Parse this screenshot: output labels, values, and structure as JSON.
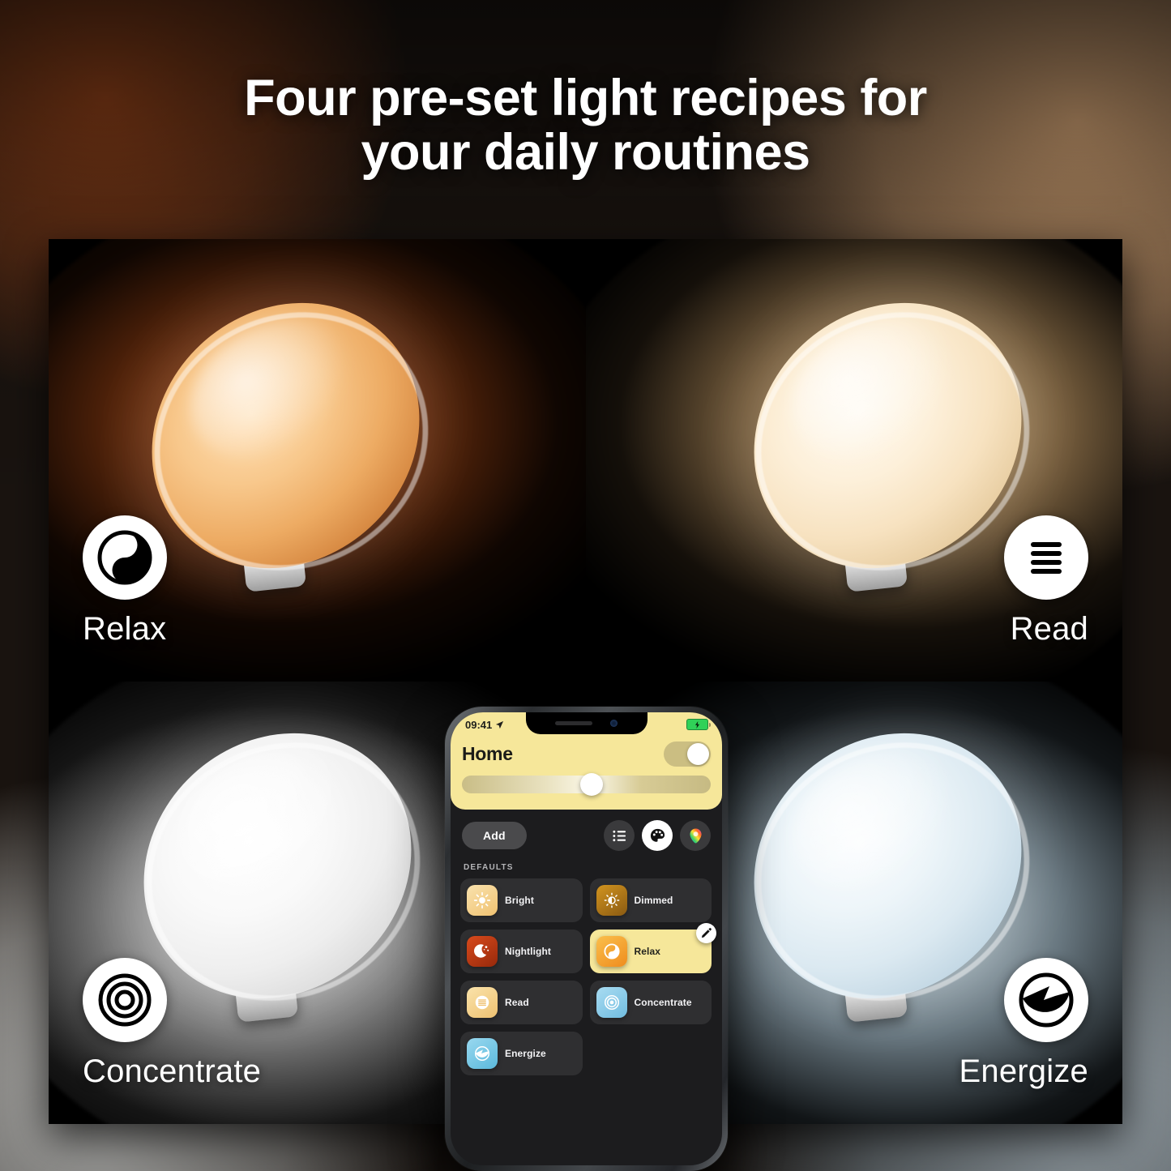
{
  "headline": {
    "line1": "Four pre-set light recipes for",
    "line2": "your daily routines"
  },
  "colors": {
    "accent_yellow": "#f6e79a",
    "panel_black": "#000000",
    "badge_white": "#ffffff",
    "battery_green": "#30d158",
    "relax_lamp": "#edab63",
    "read_lamp": "#f7e2c0",
    "concentrate_lamp": "#eeeeee",
    "energize_lamp": "#dbe9f1"
  },
  "quadrants": [
    {
      "id": "relax",
      "label": "Relax",
      "icon": "yin-yang-icon",
      "position": "top-left"
    },
    {
      "id": "read",
      "label": "Read",
      "icon": "text-lines-icon",
      "position": "top-right"
    },
    {
      "id": "concentrate",
      "label": "Concentrate",
      "icon": "concentric-rings-icon",
      "position": "bottom-left"
    },
    {
      "id": "energize",
      "label": "Energize",
      "icon": "lightning-circle-icon",
      "position": "bottom-right"
    }
  ],
  "phone": {
    "status_bar": {
      "time": "09:41",
      "location_icon": "location-arrow-icon",
      "battery_icon": "battery-charging-icon"
    },
    "header": {
      "title": "Home",
      "power_toggle": "on",
      "brightness_percent": 52
    },
    "toolbar": {
      "add_label": "Add",
      "icons": [
        {
          "name": "list-icon",
          "active": false
        },
        {
          "name": "palette-icon",
          "active": true
        },
        {
          "name": "bulb-color-icon",
          "active": false
        }
      ]
    },
    "section_header": "DEFAULTS",
    "recipes": [
      {
        "label": "Bright",
        "icon": "sun-icon",
        "icon_bg": "#f8dca0",
        "icon_bg2": "#f2c878",
        "selected": false
      },
      {
        "label": "Dimmed",
        "icon": "dim-sun-icon",
        "icon_bg": "#c8891f",
        "icon_bg2": "#8a5a12",
        "selected": false
      },
      {
        "label": "Nightlight",
        "icon": "moon-stars-icon",
        "icon_bg": "#cf4219",
        "icon_bg2": "#9e2d0d",
        "selected": false
      },
      {
        "label": "Relax",
        "icon": "yin-yang-icon",
        "icon_bg": "#f7b53f",
        "icon_bg2": "#ee8f22",
        "selected": true
      },
      {
        "label": "Read",
        "icon": "text-lines-icon",
        "icon_bg": "#f9dea4",
        "icon_bg2": "#efc474",
        "selected": false
      },
      {
        "label": "Concentrate",
        "icon": "rings-icon",
        "icon_bg": "#9ed5ee",
        "icon_bg2": "#74bfe0",
        "selected": false
      },
      {
        "label": "Energize",
        "icon": "bolt-circle-icon",
        "icon_bg": "#8ed3ec",
        "icon_bg2": "#5fbcdd",
        "selected": false
      }
    ],
    "edit_badge_icon": "pencil-icon"
  }
}
